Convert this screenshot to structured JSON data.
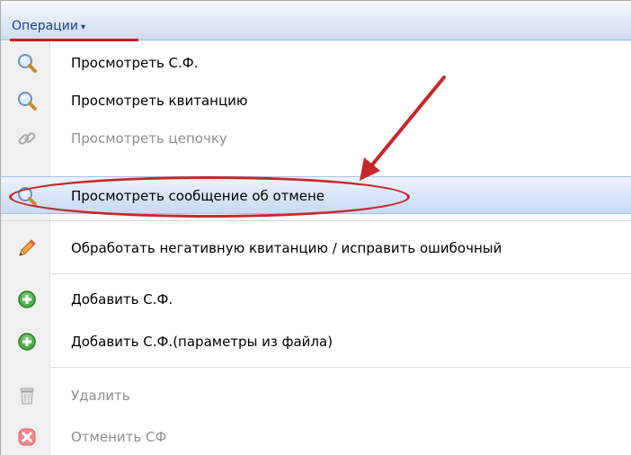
{
  "menubar": {
    "button_label": "Операции",
    "caret": "▾"
  },
  "menu": {
    "items": [
      {
        "label": "Просмотреть С.Ф.",
        "icon": "magnifier-icon",
        "enabled": true
      },
      {
        "label": "Просмотреть квитанцию",
        "icon": "magnifier-icon",
        "enabled": true
      },
      {
        "label": "Просмотреть цепочку",
        "icon": "chain-link-icon",
        "enabled": false
      },
      {
        "label": "Просмотреть сообщение об отмене",
        "icon": "magnifier-icon",
        "enabled": true,
        "highlighted": true
      },
      {
        "label": "Обработать негативную квитанцию / исправить ошибочный",
        "icon": "pencil-icon",
        "enabled": true
      },
      {
        "label": "Добавить С.Ф.",
        "icon": "green-plus-icon",
        "enabled": true
      },
      {
        "label": "Добавить С.Ф.(параметры из файла)",
        "icon": "green-plus-icon",
        "enabled": true
      },
      {
        "label": "Удалить",
        "icon": "trash-icon",
        "enabled": false
      },
      {
        "label": "Отменить СФ",
        "icon": "red-cancel-icon",
        "enabled": false
      }
    ]
  },
  "colors": {
    "accent_red": "#c62828",
    "menu_text": "#15428b",
    "disabled_text": "#8f8f8f"
  }
}
